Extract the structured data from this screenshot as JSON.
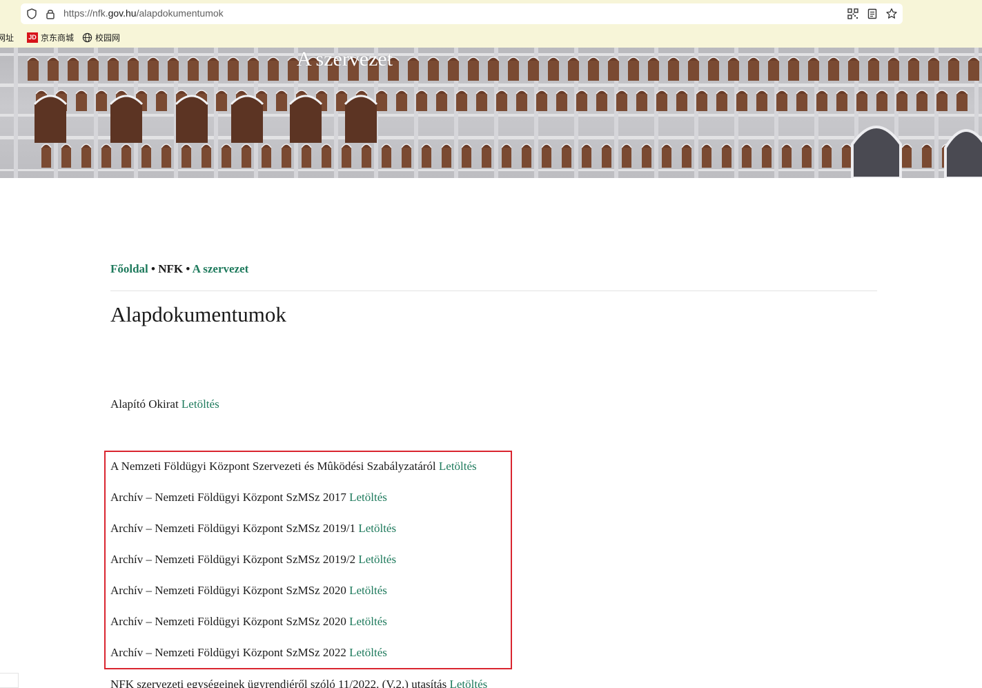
{
  "browser": {
    "url_prefix": "https://nfk.",
    "url_domain": "gov.hu",
    "url_path": "/alapdokumentumok",
    "bookmarks": [
      {
        "label": "网址",
        "icon": "globe-icon"
      },
      {
        "label": "京东商城",
        "icon": "jd-icon",
        "logo_text": "JD"
      },
      {
        "label": "校园网",
        "icon": "globe-icon"
      }
    ]
  },
  "hero": {
    "title": "A szervezet"
  },
  "breadcrumb": {
    "home": "Főoldal",
    "sep1": "•",
    "middle": "NFK",
    "sep2": "•",
    "current": "A szervezet"
  },
  "page": {
    "title": "Alapdokumentumok"
  },
  "documents": [
    {
      "text": "Alapító Okirat ",
      "link": "Letöltés"
    },
    {
      "text": "A Nemzeti Földügyi Központ Szervezeti és Mûködési Szabályzatáról  ",
      "link": "Letöltés"
    },
    {
      "text": "Archív – Nemzeti Földügyi Központ SzMSz 2017 ",
      "link": "Letöltés"
    },
    {
      "text": "Archív – Nemzeti Földügyi Központ SzMSz 2019/1 ",
      "link": "Letöltés"
    },
    {
      "text": "Archív – Nemzeti Földügyi Központ SzMSz 2019/2 ",
      "link": "Letöltés"
    },
    {
      "text": "Archív – Nemzeti Földügyi Központ SzMSz 2020 ",
      "link": "Letöltés"
    },
    {
      "text": "Archív – Nemzeti Földügyi Központ SzMSz 2020 ",
      "link": "Letöltés"
    },
    {
      "text": "Archív – Nemzeti Földügyi Központ SzMSz 2022 ",
      "link": "Letöltés"
    },
    {
      "text": "NFK szervezeti egységeinek ügyrendjéről szóló 11/2022. (V.2.) utasítás ",
      "link": "Letöltés"
    }
  ],
  "colors": {
    "link": "#1e7a5c",
    "highlight_border": "#d9252f",
    "chrome_bg": "#f7f5d8"
  }
}
